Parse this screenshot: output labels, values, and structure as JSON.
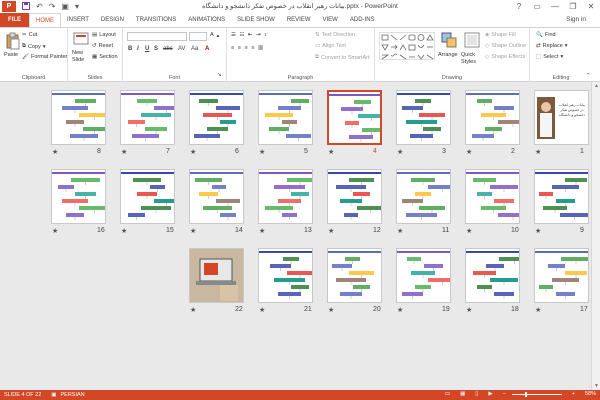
{
  "titlebar": {
    "logo": "P",
    "title": "بیانات رهبر انقلاب در خصوص تفکر دانشجو و دانشگاه.pptx - PowerPoint",
    "help": "?",
    "minimize": "—",
    "restore": "❐",
    "close": "✕"
  },
  "tabs": [
    "FILE",
    "HOME",
    "INSERT",
    "DESIGN",
    "TRANSITIONS",
    "ANIMATIONS",
    "SLIDE SHOW",
    "REVIEW",
    "VIEW",
    "ADD-INS"
  ],
  "signin": "Sign in",
  "ribbon": {
    "clipboard": {
      "label": "Clipboard",
      "paste": "Paste",
      "cut": "Cut",
      "copy": "Copy",
      "format_painter": "Format Painter"
    },
    "slides": {
      "label": "Slides",
      "new_slide": "New Slide",
      "layout": "Layout",
      "reset": "Reset",
      "section": "Section"
    },
    "font": {
      "label": "Font",
      "bold": "B",
      "italic": "I",
      "underline": "U",
      "strike": "S",
      "abc": "abc",
      "spacing": "AV",
      "case": "Aa",
      "font_color": "A"
    },
    "paragraph": {
      "label": "Paragraph",
      "text_direction": "Text Direction",
      "align_text": "Align Text",
      "convert_smartart": "Convert to SmartArt"
    },
    "drawing": {
      "label": "Drawing",
      "arrange": "Arrange",
      "quick_styles": "Quick Styles",
      "shape_fill": "Shape Fill",
      "shape_outline": "Shape Outline",
      "shape_effects": "Shape Effects"
    },
    "editing": {
      "label": "Editing",
      "find": "Find",
      "replace": "Replace",
      "select": "Select"
    }
  },
  "slides": [
    {
      "num": "1",
      "star": "★"
    },
    {
      "num": "2",
      "star": "★"
    },
    {
      "num": "3",
      "star": "★"
    },
    {
      "num": "4",
      "star": "★"
    },
    {
      "num": "5",
      "star": "★"
    },
    {
      "num": "6",
      "star": "★"
    },
    {
      "num": "7",
      "star": "★"
    },
    {
      "num": "8",
      "star": "★"
    },
    {
      "num": "9",
      "star": "★"
    },
    {
      "num": "10",
      "star": "★"
    },
    {
      "num": "11",
      "star": "★"
    },
    {
      "num": "12",
      "star": "★"
    },
    {
      "num": "13",
      "star": "★"
    },
    {
      "num": "14",
      "star": "★"
    },
    {
      "num": "15",
      "star": "★"
    },
    {
      "num": "16",
      "star": "★"
    },
    {
      "num": "17",
      "star": "★"
    },
    {
      "num": "18",
      "star": "★"
    },
    {
      "num": "19",
      "star": "★"
    },
    {
      "num": "20",
      "star": "★"
    },
    {
      "num": "21",
      "star": "★"
    },
    {
      "num": "22",
      "star": "★"
    }
  ],
  "slide1_text": "بیانات رهبر انقلاب در خصوص تفکر دانشجو و دانشگاه",
  "status": {
    "slide_of": "SLIDE 4 OF 22",
    "language": "PERSIAN",
    "zoom": "58%",
    "zoom_minus": "−",
    "zoom_plus": "+"
  },
  "colors": {
    "accent": "#d24726",
    "selected_slide": "4"
  }
}
